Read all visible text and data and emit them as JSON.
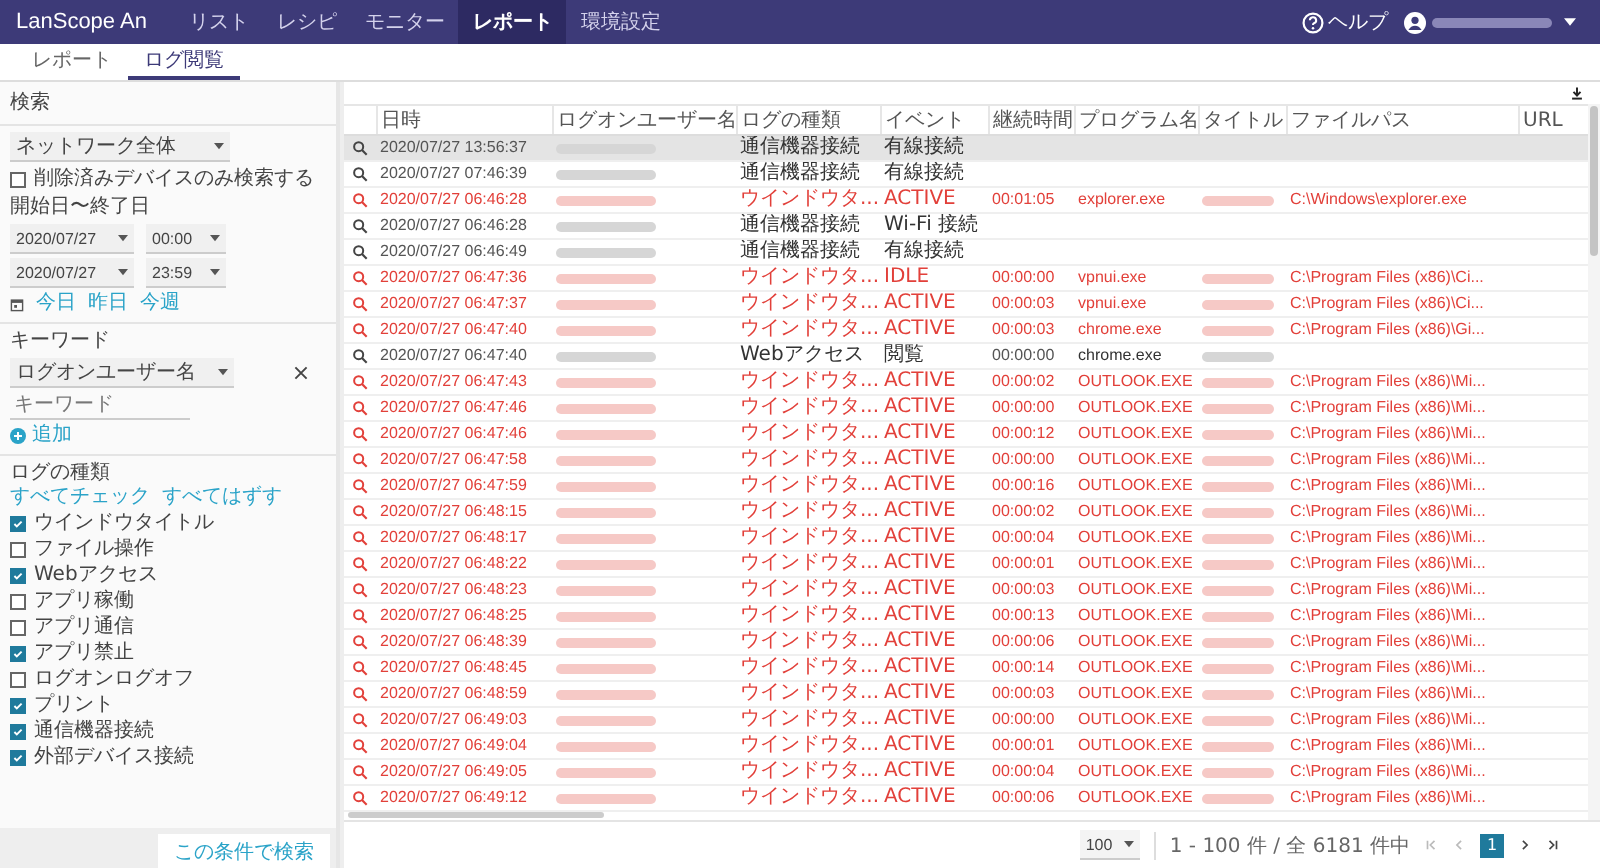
{
  "header": {
    "logo": "LanScope An",
    "nav": [
      {
        "label": "リスト",
        "selected": false
      },
      {
        "label": "レシピ",
        "selected": false
      },
      {
        "label": "モニター",
        "selected": false
      },
      {
        "label": "レポート",
        "selected": true
      },
      {
        "label": "環境設定",
        "selected": false
      }
    ],
    "help": "ヘルプ"
  },
  "subtabs": [
    {
      "label": "レポート",
      "selected": false
    },
    {
      "label": "ログ閲覧",
      "selected": true
    }
  ],
  "sidebar": {
    "title": "検索",
    "scope": "ネットワーク全体",
    "deleted_only": {
      "label": "削除済みデバイスのみ検索する",
      "checked": false
    },
    "period_label": "開始日〜終了日",
    "start": {
      "date": "2020/07/27",
      "time": "00:00"
    },
    "end": {
      "date": "2020/07/27",
      "time": "23:59"
    },
    "quick_links": [
      "今日",
      "昨日",
      "今週"
    ],
    "keyword_label": "キーワード",
    "keyword_field": "ログオンユーザー名",
    "keyword_placeholder": "キーワード",
    "add": "追加",
    "log_types_label": "ログの種類",
    "check_all": "すべてチェック",
    "uncheck_all": "すべてはずす",
    "log_types": [
      {
        "label": "ウインドウタイトル",
        "checked": true
      },
      {
        "label": "ファイル操作",
        "checked": false
      },
      {
        "label": "Webアクセス",
        "checked": true
      },
      {
        "label": "アプリ稼働",
        "checked": false
      },
      {
        "label": "アプリ通信",
        "checked": false
      },
      {
        "label": "アプリ禁止",
        "checked": true
      },
      {
        "label": "ログオンログオフ",
        "checked": false
      },
      {
        "label": "プリント",
        "checked": true
      },
      {
        "label": "通信機器接続",
        "checked": true
      },
      {
        "label": "外部デバイス接続",
        "checked": true
      }
    ],
    "search_button": "この条件で検索"
  },
  "table": {
    "columns": [
      "日時",
      "ログオンユーザー名",
      "ログの種類",
      "イベント",
      "継続時間",
      "プログラム名",
      "タイトル",
      "ファイルパス",
      "URL"
    ],
    "rows": [
      {
        "kind": "device",
        "selected": true,
        "time": "2020/07/27 13:56:37",
        "type": "通信機器接続",
        "event": "有線接続",
        "title_redacted": false
      },
      {
        "kind": "device",
        "selected": false,
        "time": "2020/07/27 07:46:39",
        "type": "通信機器接続",
        "event": "有線接続",
        "title_redacted": false
      },
      {
        "kind": "window",
        "selected": false,
        "time": "2020/07/27 06:46:28",
        "type": "ウインドウタ...",
        "event": "ACTIVE",
        "duration": "00:01:05",
        "program": "explorer.exe",
        "title_redacted": true,
        "filepath": "C:\\Windows\\explorer.exe"
      },
      {
        "kind": "device",
        "selected": false,
        "time": "2020/07/27 06:46:28",
        "type": "通信機器接続",
        "event": "Wi-Fi 接続",
        "title_redacted": false
      },
      {
        "kind": "device",
        "selected": false,
        "time": "2020/07/27 06:46:49",
        "type": "通信機器接続",
        "event": "有線接続",
        "title_redacted": false
      },
      {
        "kind": "window",
        "selected": false,
        "time": "2020/07/27 06:47:36",
        "type": "ウインドウタ...",
        "event": "IDLE",
        "duration": "00:00:00",
        "program": "vpnui.exe",
        "title_redacted": true,
        "filepath": "C:\\Program Files (x86)\\Ci..."
      },
      {
        "kind": "window",
        "selected": false,
        "time": "2020/07/27 06:47:37",
        "type": "ウインドウタ...",
        "event": "ACTIVE",
        "duration": "00:00:03",
        "program": "vpnui.exe",
        "title_redacted": true,
        "filepath": "C:\\Program Files (x86)\\Ci..."
      },
      {
        "kind": "window",
        "selected": false,
        "time": "2020/07/27 06:47:40",
        "type": "ウインドウタ...",
        "event": "ACTIVE",
        "duration": "00:00:03",
        "program": "chrome.exe",
        "title_redacted": true,
        "filepath": "C:\\Program Files (x86)\\Gi..."
      },
      {
        "kind": "web",
        "selected": false,
        "time": "2020/07/27 06:47:40",
        "type": "Webアクセス",
        "event": "閲覧",
        "duration": "00:00:00",
        "program": "chrome.exe",
        "title_redacted": true
      },
      {
        "kind": "window",
        "selected": false,
        "time": "2020/07/27 06:47:43",
        "type": "ウインドウタ...",
        "event": "ACTIVE",
        "duration": "00:00:02",
        "program": "OUTLOOK.EXE",
        "title_redacted": true,
        "filepath": "C:\\Program Files (x86)\\Mi..."
      },
      {
        "kind": "window",
        "selected": false,
        "time": "2020/07/27 06:47:46",
        "type": "ウインドウタ...",
        "event": "ACTIVE",
        "duration": "00:00:00",
        "program": "OUTLOOK.EXE",
        "title_redacted": true,
        "filepath": "C:\\Program Files (x86)\\Mi..."
      },
      {
        "kind": "window",
        "selected": false,
        "time": "2020/07/27 06:47:46",
        "type": "ウインドウタ...",
        "event": "ACTIVE",
        "duration": "00:00:12",
        "program": "OUTLOOK.EXE",
        "title_redacted": true,
        "filepath": "C:\\Program Files (x86)\\Mi..."
      },
      {
        "kind": "window",
        "selected": false,
        "time": "2020/07/27 06:47:58",
        "type": "ウインドウタ...",
        "event": "ACTIVE",
        "duration": "00:00:00",
        "program": "OUTLOOK.EXE",
        "title_redacted": true,
        "filepath": "C:\\Program Files (x86)\\Mi..."
      },
      {
        "kind": "window",
        "selected": false,
        "time": "2020/07/27 06:47:59",
        "type": "ウインドウタ...",
        "event": "ACTIVE",
        "duration": "00:00:16",
        "program": "OUTLOOK.EXE",
        "title_redacted": true,
        "filepath": "C:\\Program Files (x86)\\Mi..."
      },
      {
        "kind": "window",
        "selected": false,
        "time": "2020/07/27 06:48:15",
        "type": "ウインドウタ...",
        "event": "ACTIVE",
        "duration": "00:00:02",
        "program": "OUTLOOK.EXE",
        "title_redacted": true,
        "filepath": "C:\\Program Files (x86)\\Mi..."
      },
      {
        "kind": "window",
        "selected": false,
        "time": "2020/07/27 06:48:17",
        "type": "ウインドウタ...",
        "event": "ACTIVE",
        "duration": "00:00:04",
        "program": "OUTLOOK.EXE",
        "title_redacted": true,
        "filepath": "C:\\Program Files (x86)\\Mi..."
      },
      {
        "kind": "window",
        "selected": false,
        "time": "2020/07/27 06:48:22",
        "type": "ウインドウタ...",
        "event": "ACTIVE",
        "duration": "00:00:01",
        "program": "OUTLOOK.EXE",
        "title_redacted": true,
        "filepath": "C:\\Program Files (x86)\\Mi..."
      },
      {
        "kind": "window",
        "selected": false,
        "time": "2020/07/27 06:48:23",
        "type": "ウインドウタ...",
        "event": "ACTIVE",
        "duration": "00:00:03",
        "program": "OUTLOOK.EXE",
        "title_redacted": true,
        "filepath": "C:\\Program Files (x86)\\Mi..."
      },
      {
        "kind": "window",
        "selected": false,
        "time": "2020/07/27 06:48:25",
        "type": "ウインドウタ...",
        "event": "ACTIVE",
        "duration": "00:00:13",
        "program": "OUTLOOK.EXE",
        "title_redacted": true,
        "filepath": "C:\\Program Files (x86)\\Mi..."
      },
      {
        "kind": "window",
        "selected": false,
        "time": "2020/07/27 06:48:39",
        "type": "ウインドウタ...",
        "event": "ACTIVE",
        "duration": "00:00:06",
        "program": "OUTLOOK.EXE",
        "title_redacted": true,
        "filepath": "C:\\Program Files (x86)\\Mi..."
      },
      {
        "kind": "window",
        "selected": false,
        "time": "2020/07/27 06:48:45",
        "type": "ウインドウタ...",
        "event": "ACTIVE",
        "duration": "00:00:14",
        "program": "OUTLOOK.EXE",
        "title_redacted": true,
        "filepath": "C:\\Program Files (x86)\\Mi..."
      },
      {
        "kind": "window",
        "selected": false,
        "time": "2020/07/27 06:48:59",
        "type": "ウインドウタ...",
        "event": "ACTIVE",
        "duration": "00:00:03",
        "program": "OUTLOOK.EXE",
        "title_redacted": true,
        "filepath": "C:\\Program Files (x86)\\Mi..."
      },
      {
        "kind": "window",
        "selected": false,
        "time": "2020/07/27 06:49:03",
        "type": "ウインドウタ...",
        "event": "ACTIVE",
        "duration": "00:00:00",
        "program": "OUTLOOK.EXE",
        "title_redacted": true,
        "filepath": "C:\\Program Files (x86)\\Mi..."
      },
      {
        "kind": "window",
        "selected": false,
        "time": "2020/07/27 06:49:04",
        "type": "ウインドウタ...",
        "event": "ACTIVE",
        "duration": "00:00:01",
        "program": "OUTLOOK.EXE",
        "title_redacted": true,
        "filepath": "C:\\Program Files (x86)\\Mi..."
      },
      {
        "kind": "window",
        "selected": false,
        "time": "2020/07/27 06:49:05",
        "type": "ウインドウタ...",
        "event": "ACTIVE",
        "duration": "00:00:04",
        "program": "OUTLOOK.EXE",
        "title_redacted": true,
        "filepath": "C:\\Program Files (x86)\\Mi..."
      },
      {
        "kind": "window",
        "selected": false,
        "time": "2020/07/27 06:49:12",
        "type": "ウインドウタ...",
        "event": "ACTIVE",
        "duration": "00:00:06",
        "program": "OUTLOOK.EXE",
        "title_redacted": true,
        "filepath": "C:\\Program Files (x86)\\Mi..."
      }
    ]
  },
  "pagination": {
    "page_size": "100",
    "range": "1 - 100 件 / 全 6181 件中",
    "pages": [
      {
        "label": "1",
        "selected": true
      }
    ]
  }
}
